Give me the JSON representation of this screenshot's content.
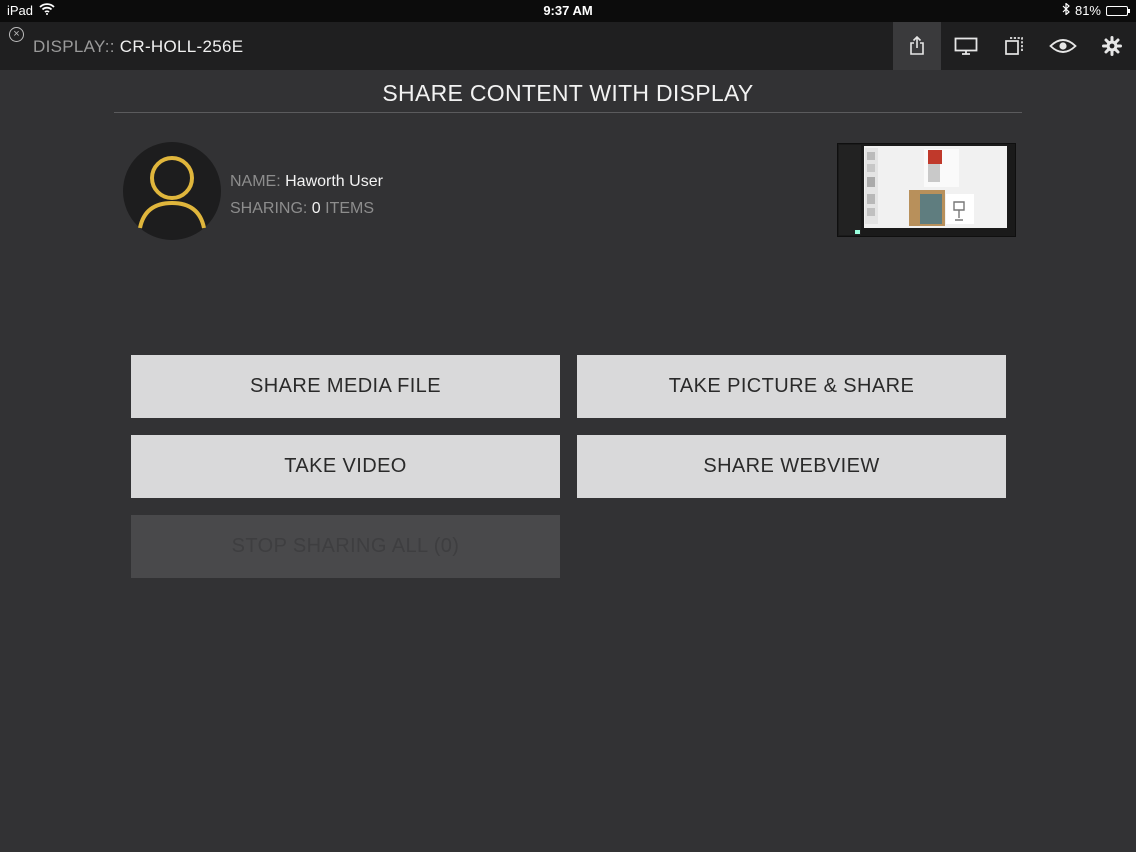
{
  "status_bar": {
    "device": "iPad",
    "time": "9:37 AM",
    "battery_percent": "81%",
    "battery_level": 0.81
  },
  "top_bar": {
    "display_prefix": "DISPLAY::",
    "display_name": "CR-HOLL-256E",
    "close_icon": "close-circle-icon",
    "icons": [
      "share-icon",
      "monitor-icon",
      "layers-icon",
      "eye-icon",
      "gear-icon"
    ],
    "active_icon": "share-icon"
  },
  "header": {
    "title": "SHARE CONTENT WITH DISPLAY"
  },
  "user": {
    "name_label": "NAME:",
    "name_value": "Haworth User",
    "sharing_label": "SHARING:",
    "sharing_count": "0",
    "sharing_suffix": "ITEMS"
  },
  "buttons": {
    "share_media": "SHARE MEDIA FILE",
    "take_picture": "TAKE PICTURE & SHARE",
    "take_video": "TAKE VIDEO",
    "share_webview": "SHARE WEBVIEW",
    "stop_sharing": "STOP SHARING ALL (0)"
  },
  "colors": {
    "background": "#323234",
    "top_bar": "#1f1f20",
    "accent_gold": "#e0b63c",
    "button": "#d9d9da",
    "button_disabled": "#49494b"
  }
}
